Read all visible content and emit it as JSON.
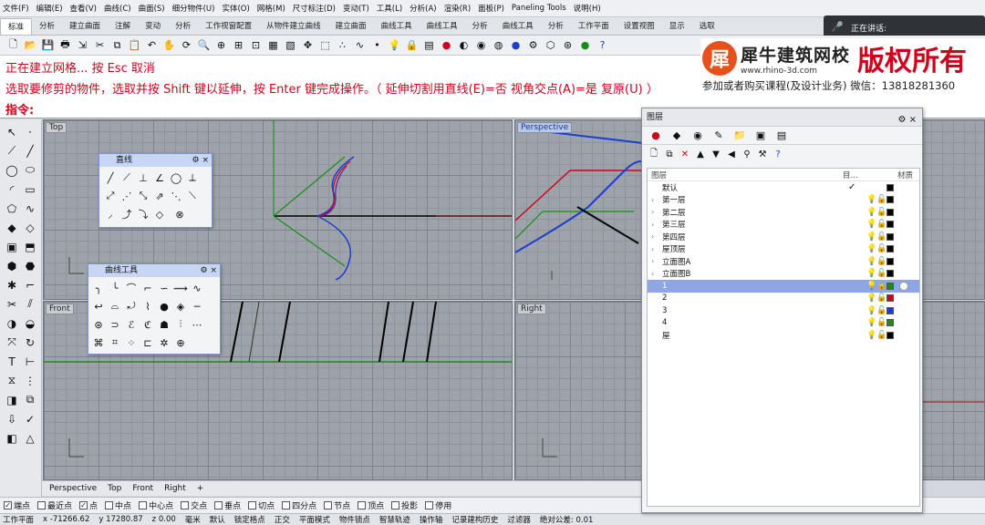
{
  "menubar": {
    "items": [
      "文件(F)",
      "编辑(E)",
      "查看(V)",
      "曲线(C)",
      "曲面(S)",
      "细分物件(U)",
      "实体(O)",
      "网格(M)",
      "尺寸标注(D)",
      "变动(T)",
      "工具(L)",
      "分析(A)",
      "渲染(R)",
      "面板(P)",
      "Paneling Tools",
      "说明(H)"
    ]
  },
  "tabbar": {
    "items": [
      "标准",
      "分析",
      "建立曲面",
      "注解",
      "变动",
      "分析",
      "工作视窗配置",
      "从物件建立曲线",
      "建立曲面",
      "曲线工具",
      "曲线工具",
      "分析",
      "曲线工具",
      "分析",
      "工作平面",
      "设置视图",
      "显示",
      "选取"
    ]
  },
  "speaking": {
    "label": "正在讲话:"
  },
  "command": {
    "line1": "正在建立网格... 按 Esc 取消",
    "line2": "选取要修剪的物件，选取并按 Shift 键以延伸，按 Enter 键完成操作。（ 延伸切割用直线(E)=否  视角交点(A)=是  复原(U) ）",
    "prompt": "指令:"
  },
  "logo": {
    "mark": "犀",
    "name": "犀牛建筑网校",
    "url": "www.rhino-3d.com",
    "right": "版权所有"
  },
  "promo": {
    "text": "参加或者购买课程(及设计业务) 微信：13818281360"
  },
  "viewports": {
    "top": "Top",
    "perspective": "Perspective",
    "front": "Front",
    "right": "Right"
  },
  "panels": {
    "line": {
      "title": "直线"
    },
    "curvetools": {
      "title": "曲线工具"
    }
  },
  "vptabs": [
    "Perspective",
    "Top",
    "Front",
    "Right"
  ],
  "osnap": [
    {
      "label": "端点",
      "checked": true
    },
    {
      "label": "最近点",
      "checked": false
    },
    {
      "label": "点",
      "checked": true
    },
    {
      "label": "中点",
      "checked": false
    },
    {
      "label": "中心点",
      "checked": false
    },
    {
      "label": "交点",
      "checked": false
    },
    {
      "label": "垂点",
      "checked": false
    },
    {
      "label": "切点",
      "checked": false
    },
    {
      "label": "四分点",
      "checked": false
    },
    {
      "label": "节点",
      "checked": false
    },
    {
      "label": "顶点",
      "checked": false
    },
    {
      "label": "投影",
      "checked": false
    },
    {
      "label": "停用",
      "checked": false
    }
  ],
  "status": {
    "cplane": "工作平面",
    "x": "x -71266.62",
    "y": "y 17280.87",
    "z": "z 0.00",
    "unit": "毫米",
    "layer": "默认",
    "items": [
      "锁定格点",
      "正交",
      "平面模式",
      "物件锁点",
      "智慧轨迹",
      "操作轴",
      "记录建构历史",
      "过滤器",
      "绝对公差: 0.01"
    ]
  },
  "layers": {
    "title": "图层",
    "header": {
      "name": "图层",
      "current": "目...",
      "material": "材质"
    },
    "rows": [
      {
        "name": "默认",
        "current": true,
        "color": "#000000",
        "expand": false
      },
      {
        "name": "第一层",
        "color": "#000000",
        "expand": true
      },
      {
        "name": "第二层",
        "color": "#000000",
        "expand": true
      },
      {
        "name": "第三层",
        "color": "#000000",
        "expand": true
      },
      {
        "name": "第四层",
        "color": "#000000",
        "expand": true
      },
      {
        "name": "屋顶层",
        "color": "#000000",
        "expand": true
      },
      {
        "name": "立面图A",
        "color": "#000000",
        "expand": true
      },
      {
        "name": "立面图B",
        "color": "#000000",
        "expand": true
      },
      {
        "name": "1",
        "color": "#1a8c1a",
        "expand": false,
        "selected": true
      },
      {
        "name": "2",
        "color": "#d0021b",
        "expand": false
      },
      {
        "name": "3",
        "color": "#1a3fd0",
        "expand": false
      },
      {
        "name": "4",
        "color": "#1a8c1a",
        "expand": false
      },
      {
        "name": "屋",
        "color": "#000000",
        "expand": false
      }
    ]
  }
}
